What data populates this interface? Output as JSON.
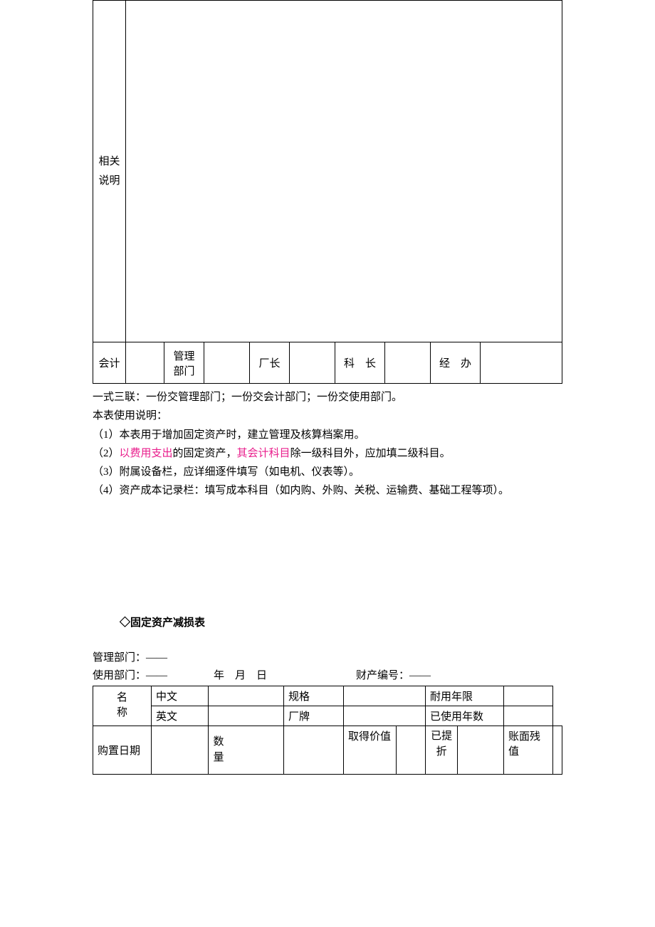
{
  "table1": {
    "row1_label": "相关说明",
    "row2": {
      "c1": "会计",
      "c3": "管理部门",
      "c5": "厂长",
      "c7": "科　长",
      "c9": "经　办"
    }
  },
  "notes": {
    "line1": "一式三联：一份交管理部门；一份交会计部门；一份交使用部门。",
    "line2": "本表使用说明：",
    "line3_pre": "（1）本表用于增加固定资产时，建立管理及核算档案用。",
    "line4_a": "（2）",
    "line4_pink1": "以费用支出",
    "line4_b": "的固定资产，",
    "line4_pink2": "其会计科目",
    "line4_c": "除一级科目外，应加填二级科目。",
    "line5": "（3）附属设备栏，应详细逐件填写（如电机、仪表等）。",
    "line6": "（4）资产成本记录栏：填写成本科目（如内购、外购、关税、运输费、基础工程等项）。"
  },
  "section2": {
    "title": "◇固定资产减损表",
    "meta1_label": "管理部门：",
    "meta1_val": "——",
    "meta2_label": "使用部门：",
    "meta2_val": "——",
    "meta2_date": "年　月　日",
    "meta2_prop_label": "财产编号：",
    "meta2_prop_val": "——"
  },
  "table2": {
    "r1c1": "名",
    "r1c2": "中文",
    "r1c4": "规格",
    "r1c6": "耐用年限",
    "r2c1": "称",
    "r2c2": "英文",
    "r2c4": "厂牌",
    "r2c6": "已使用年数",
    "r3c1": "购置日期",
    "r3c3": "数量",
    "r3c5": "取得价值",
    "r3c7": "已提折",
    "r3c9": "账面残值"
  }
}
